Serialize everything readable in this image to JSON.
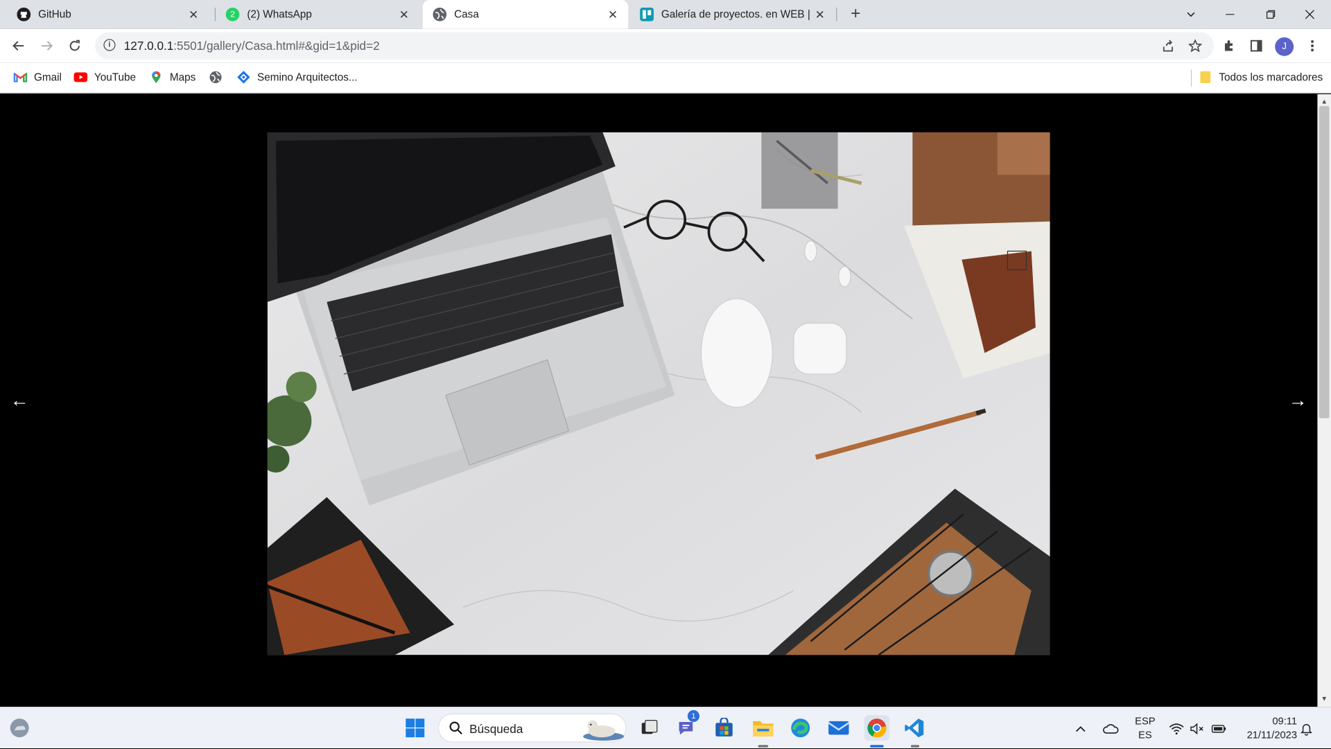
{
  "browser": {
    "tabs": [
      {
        "title": "GitHub",
        "close": "✕"
      },
      {
        "title": "(2) WhatsApp",
        "close": "✕",
        "badge": "2"
      },
      {
        "title": "Casa",
        "close": "✕"
      },
      {
        "title": "Galería de proyectos. en WEB | T",
        "close": "✕"
      }
    ],
    "new_tab": "+",
    "url_host": "127.0.0.1",
    "url_rest": ":5501/gallery/Casa.html#&gid=1&pid=2",
    "profile_initial": "J"
  },
  "bookmarks": {
    "items": [
      {
        "label": "Gmail"
      },
      {
        "label": "YouTube"
      },
      {
        "label": "Maps"
      },
      {
        "label": "Semino Arquitectos..."
      }
    ],
    "all_bookmarks": "Todos los marcadores"
  },
  "gallery": {
    "prev_arrow": "←",
    "next_arrow": "→"
  },
  "taskbar": {
    "search_placeholder": "Búsqueda",
    "teams_badge": "1",
    "lang_top": "ESP",
    "lang_bottom": "ES",
    "time": "09:11",
    "date": "21/11/2023"
  },
  "colors": {
    "tabstrip_bg": "#dee1e6",
    "active_tab_bg": "#ffffff",
    "viewer_bg": "#000000",
    "taskbar_bg": "#eef1f8"
  }
}
